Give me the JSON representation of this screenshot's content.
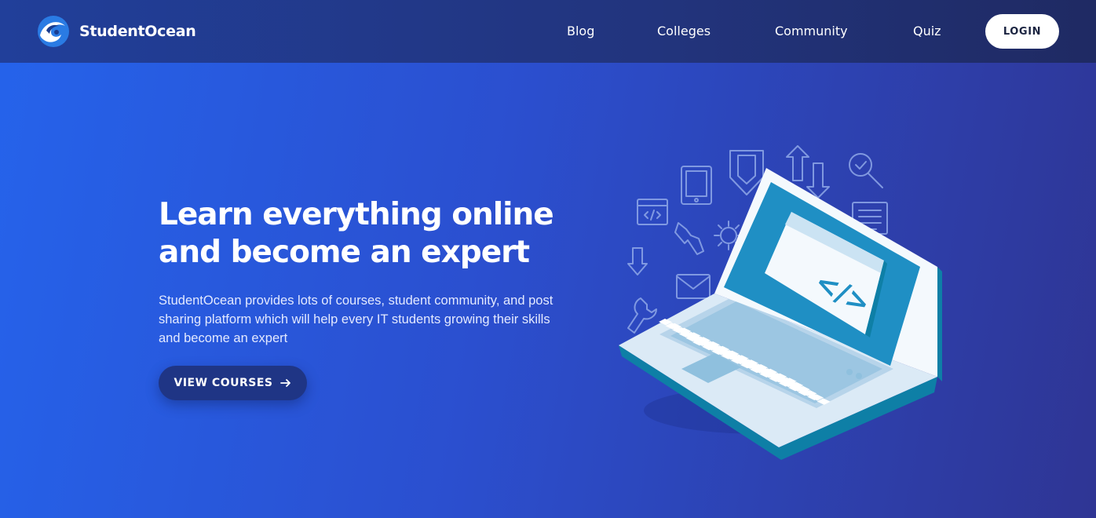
{
  "brand": {
    "name": "StudentOcean",
    "logo_icon": "wave-logo-icon",
    "logo_colors": {
      "circle": "#2a7be4",
      "wave": "#ffffff",
      "shadow": "#1a3c8f"
    }
  },
  "nav": {
    "links": [
      "Blog",
      "Colleges",
      "Community",
      "Quiz"
    ],
    "login_label": "LOGIN"
  },
  "hero": {
    "title_line1": "Learn everything online",
    "title_line2": "and become an expert",
    "description": "StudentOcean provides lots of courses, student community, and post sharing platform which will help every IT students growing their skills and become an expert",
    "cta_label": "VIEW COURSES",
    "cta_icon": "arrow-right-icon"
  },
  "illustration": {
    "type": "laptop-with-code-icon",
    "screen_glyph": "</>",
    "colors": {
      "screen_bezel": "#1f8fc4",
      "laptop_body": "#dbeaf6",
      "laptop_edge": "#0e7fa6",
      "keys": "#ffffff",
      "outline_icons": "#8fa8e8"
    }
  },
  "theme": {
    "hero_gradient_start": "#2563eb",
    "hero_gradient_end": "#2f3594",
    "navbar": "#22347d",
    "cta_bg": "#1f3585"
  }
}
